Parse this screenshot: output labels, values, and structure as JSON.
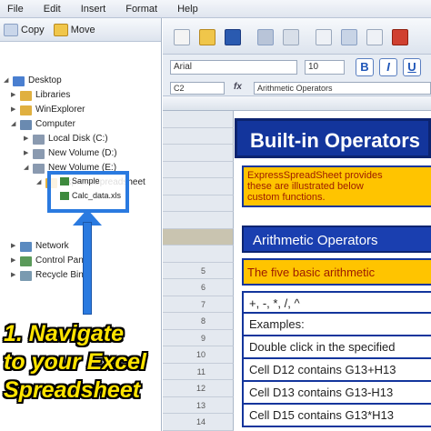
{
  "menubar": {
    "items": [
      "File",
      "Edit",
      "Insert",
      "Format",
      "Help"
    ]
  },
  "left_toolbar": {
    "copy_label": "Copy",
    "move_label": "Move"
  },
  "tree": {
    "items": [
      {
        "label": "Desktop",
        "level": 0,
        "color": "#4a7fd0"
      },
      {
        "label": "Libraries",
        "level": 1,
        "color": "#e0b040"
      },
      {
        "label": "WinExplorer",
        "level": 1,
        "color": "#e0b040"
      },
      {
        "label": "Computer",
        "level": 1,
        "color": "#6a8ab0"
      },
      {
        "label": "Local Disk (C:)",
        "level": 2,
        "color": "#8a9ab0"
      },
      {
        "label": "New Volume (D:)",
        "level": 2,
        "color": "#8a9ab0"
      },
      {
        "label": "New Volume (E:)",
        "level": 2,
        "color": "#8a9ab0"
      },
      {
        "label": "ExpressSpreadsheet",
        "level": 3,
        "color": "#e0b040"
      },
      {
        "label": "Network",
        "level": 1,
        "color": "#5a8ac0"
      },
      {
        "label": "Control Panel",
        "level": 1,
        "color": "#5a9a5a"
      },
      {
        "label": "Recycle Bin",
        "level": 1,
        "color": "#7a9ab0"
      }
    ],
    "highlighted": [
      "Sample",
      "Calc_data.xls"
    ]
  },
  "callout": {
    "lines": [
      "1. Navigate",
      "to your Excel",
      "Spreadsheet"
    ]
  },
  "format_bar": {
    "font_name": "Arial",
    "font_size": "10",
    "bold_label": "B",
    "italic_label": "I",
    "underline_label": "U",
    "cell_ref": "C2",
    "fx_label": "fx",
    "formula": "Arithmetic Operators"
  },
  "row_numbers": [
    "",
    "",
    "",
    "",
    "",
    "",
    "",
    "",
    "",
    "5",
    "6",
    "7",
    "8",
    "9",
    "10",
    "11",
    "12",
    "13",
    "14"
  ],
  "document": {
    "title": "Built-in Operators",
    "intro_lines": [
      "ExpressSpreadSheet provides",
      "these are illustrated below",
      "custom functions."
    ],
    "subheading": "Arithmetic Operators",
    "basic_line": "The five basic arithmetic",
    "lines": [
      "+, -, *, /, ^",
      "Examples:",
      "Double click in the specified",
      "Cell D12 contains G13+H13",
      "Cell D13 contains G13-H13",
      "Cell D15 contains G13*H13"
    ]
  }
}
